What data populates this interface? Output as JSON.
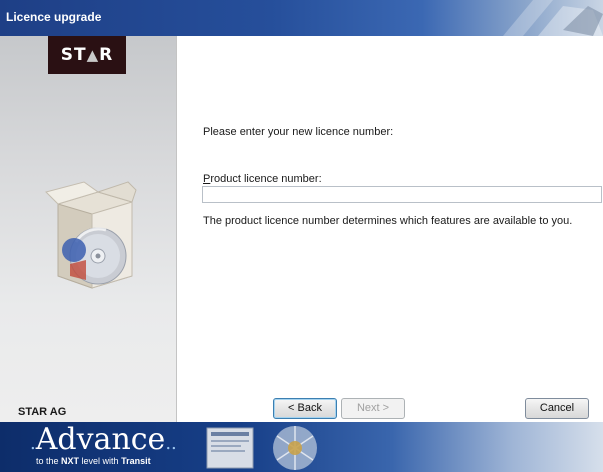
{
  "window": {
    "title": "Licence upgrade"
  },
  "sidebar": {
    "logo_left": "ST",
    "logo_mark": "▲",
    "logo_right": "R",
    "company": "STAR AG"
  },
  "main": {
    "prompt": "Please enter your new licence number:",
    "field_label_accel": "P",
    "field_label_rest": "roduct licence number:",
    "field_value": "",
    "field_placeholder": "",
    "info": "The product licence number determines which features are available to you."
  },
  "buttons": {
    "back_label": "< Back",
    "next_label": "Next >",
    "cancel_label": "Cancel"
  },
  "banner": {
    "brand": "Advance",
    "brand_dots_left": ".",
    "brand_dots_right": "..",
    "tagline_pre": "to the ",
    "tagline_nxt": "NXT",
    "tagline_mid": " level with ",
    "tagline_transit": "Transit"
  },
  "colors": {
    "titlebar": "#264f9b",
    "logo_bg": "#2a1013",
    "banner": "#173f88"
  },
  "icons": [
    "product-box-icon",
    "cd-disc-icon"
  ]
}
